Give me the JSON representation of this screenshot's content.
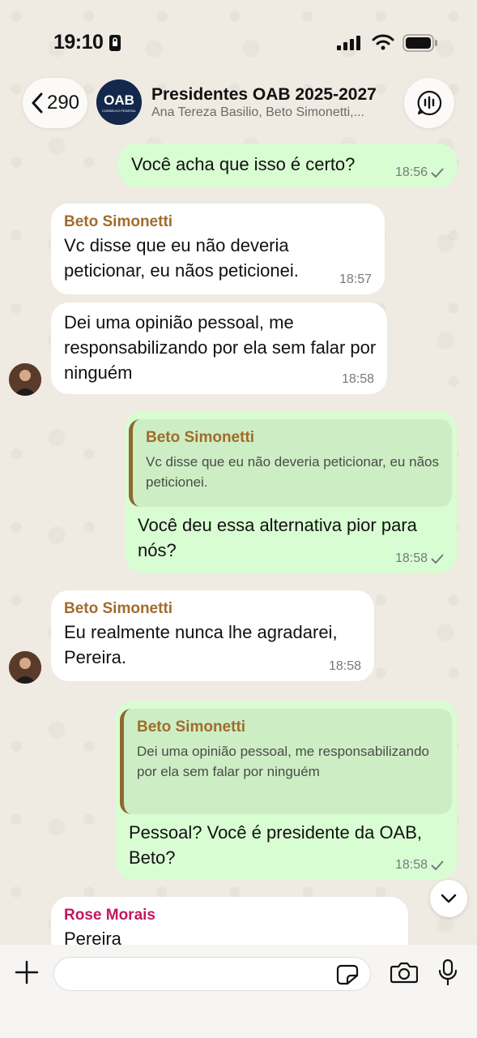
{
  "status": {
    "time": "19:10"
  },
  "header": {
    "back_count": "290",
    "title": "Presidentes OAB 2025-2027",
    "subtitle": "Ana Tereza Basilio, Beto Simonetti,...",
    "avatar_text": "OAB",
    "avatar_subtext": "CONSELHO FEDERAL"
  },
  "messages": [
    {
      "dir": "out",
      "text": "Você acha que isso é certo?",
      "time": "18:56"
    },
    {
      "dir": "in",
      "sender": "Beto Simonetti",
      "text": "Vc disse que eu não deveria peticionar, eu nãos peticionei.",
      "time": "18:57"
    },
    {
      "dir": "in",
      "text": "Dei uma opinião pessoal, me responsabilizando por ela sem falar por ninguém",
      "time": "18:58"
    },
    {
      "dir": "out",
      "quote_sender": "Beto Simonetti",
      "quote_text": "Vc disse que eu não deveria peticionar, eu nãos peticionei.",
      "text": "Você deu essa alternativa pior para nós?",
      "time": "18:58"
    },
    {
      "dir": "in",
      "sender": "Beto Simonetti",
      "text": "Eu realmente nunca lhe agradarei, Pereira.",
      "time": "18:58"
    },
    {
      "dir": "out",
      "quote_sender": "Beto Simonetti",
      "quote_text": "Dei uma opinião pessoal, me responsabilizando por ela sem falar por ninguém",
      "text": "Pessoal? Você é presidente da OAB, Beto?",
      "time": "18:58"
    },
    {
      "dir": "in",
      "sender": "Rose Morais",
      "text": "Pereira"
    }
  ],
  "colors": {
    "outgoing_bubble": "#d9fdd3",
    "incoming_bubble": "#ffffff",
    "sender_name": "#a26b2c",
    "sender_rose": "#c2185b",
    "wallpaper": "#efeae2"
  }
}
